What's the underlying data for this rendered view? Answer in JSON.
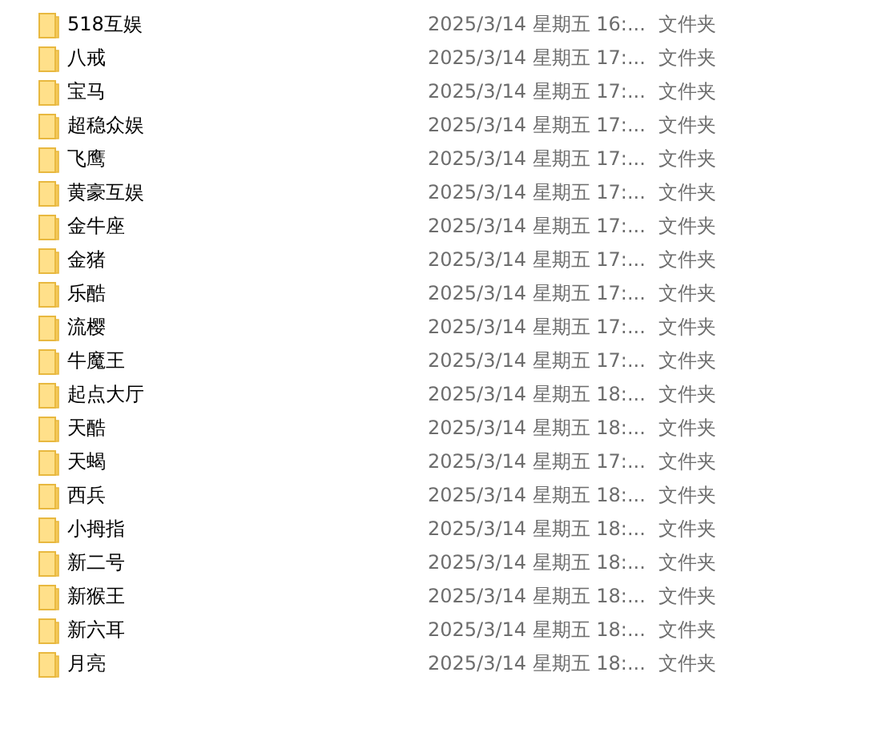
{
  "rows": [
    {
      "name": "518互娱",
      "date_modified": "2025/3/14 星期五 16:...",
      "type": "文件夹"
    },
    {
      "name": "八戒",
      "date_modified": "2025/3/14 星期五 17:...",
      "type": "文件夹"
    },
    {
      "name": "宝马",
      "date_modified": "2025/3/14 星期五 17:...",
      "type": "文件夹"
    },
    {
      "name": "超稳众娱",
      "date_modified": "2025/3/14 星期五 17:...",
      "type": "文件夹"
    },
    {
      "name": "飞鹰",
      "date_modified": "2025/3/14 星期五 17:...",
      "type": "文件夹"
    },
    {
      "name": "黄豪互娱",
      "date_modified": "2025/3/14 星期五 17:...",
      "type": "文件夹"
    },
    {
      "name": "金牛座",
      "date_modified": "2025/3/14 星期五 17:...",
      "type": "文件夹"
    },
    {
      "name": "金猪",
      "date_modified": "2025/3/14 星期五 17:...",
      "type": "文件夹"
    },
    {
      "name": "乐酷",
      "date_modified": "2025/3/14 星期五 17:...",
      "type": "文件夹"
    },
    {
      "name": "流樱",
      "date_modified": "2025/3/14 星期五 17:...",
      "type": "文件夹"
    },
    {
      "name": "牛魔王",
      "date_modified": "2025/3/14 星期五 17:...",
      "type": "文件夹"
    },
    {
      "name": "起点大厅",
      "date_modified": "2025/3/14 星期五 18:...",
      "type": "文件夹"
    },
    {
      "name": "天酷",
      "date_modified": "2025/3/14 星期五 18:...",
      "type": "文件夹"
    },
    {
      "name": "天蝎",
      "date_modified": "2025/3/14 星期五 17:...",
      "type": "文件夹"
    },
    {
      "name": "西兵",
      "date_modified": "2025/3/14 星期五 18:...",
      "type": "文件夹"
    },
    {
      "name": "小拇指",
      "date_modified": "2025/3/14 星期五 18:...",
      "type": "文件夹"
    },
    {
      "name": "新二号",
      "date_modified": "2025/3/14 星期五 18:...",
      "type": "文件夹"
    },
    {
      "name": "新猴王",
      "date_modified": "2025/3/14 星期五 18:...",
      "type": "文件夹"
    },
    {
      "name": "新六耳",
      "date_modified": "2025/3/14 星期五 18:...",
      "type": "文件夹"
    },
    {
      "name": "月亮",
      "date_modified": "2025/3/14 星期五 18:...",
      "type": "文件夹"
    }
  ]
}
